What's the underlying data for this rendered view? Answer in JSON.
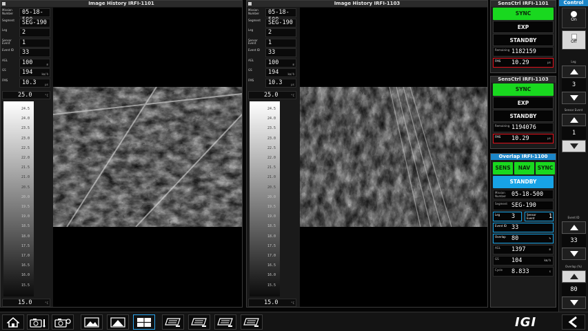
{
  "left_panel": {
    "title": "Image History IRFI-1101",
    "info": [
      {
        "label": "Mission Number",
        "value": "05-18-500",
        "unit": ""
      },
      {
        "label": "Segment",
        "value": "SEG-190",
        "unit": ""
      },
      {
        "label": "Leg",
        "value": "2",
        "unit": ""
      },
      {
        "label": "Sensor Event",
        "value": "1",
        "unit": ""
      },
      {
        "label": "Event ID",
        "value": "33",
        "unit": ""
      },
      {
        "label": "AGL",
        "value": "100",
        "unit": "m"
      },
      {
        "label": "GS",
        "value": "194",
        "unit": "km/h"
      },
      {
        "label": "FMS",
        "value": "10.3",
        "unit": "µs"
      }
    ],
    "scale_top": "25.0",
    "scale_bottom": "15.0",
    "scale_unit": "°C",
    "ticks": [
      "24.5",
      "24.0",
      "23.5",
      "23.0",
      "22.5",
      "22.0",
      "21.5",
      "21.0",
      "20.5",
      "20.0",
      "19.5",
      "19.0",
      "18.5",
      "18.0",
      "17.5",
      "17.0",
      "16.5",
      "16.0",
      "15.5"
    ]
  },
  "right_panel": {
    "title": "Image History IRFI-1103",
    "info": [
      {
        "label": "Mission Number",
        "value": "05-18-500",
        "unit": ""
      },
      {
        "label": "Segment",
        "value": "SEG-190",
        "unit": ""
      },
      {
        "label": "Leg",
        "value": "2",
        "unit": ""
      },
      {
        "label": "Sensor Event",
        "value": "1",
        "unit": ""
      },
      {
        "label": "Event ID",
        "value": "33",
        "unit": ""
      },
      {
        "label": "AGL",
        "value": "100",
        "unit": "m"
      },
      {
        "label": "GS",
        "value": "194",
        "unit": "km/h"
      },
      {
        "label": "FMS",
        "value": "10.3",
        "unit": "µs"
      }
    ],
    "scale_top": "25.0",
    "scale_bottom": "15.0",
    "scale_unit": "°C",
    "ticks": [
      "24.5",
      "24.0",
      "23.5",
      "23.0",
      "22.5",
      "22.0",
      "21.5",
      "21.0",
      "20.5",
      "20.0",
      "19.5",
      "19.0",
      "18.5",
      "18.0",
      "17.5",
      "17.0",
      "16.5",
      "16.0",
      "15.5"
    ]
  },
  "sensctrl1": {
    "title": "SensCtrl IRFI-1101",
    "sync": "SYNC",
    "exp": "EXP",
    "standby": "STANDBY",
    "remaining_label": "Remaining",
    "remaining": "1182159",
    "fms_label": "FMS",
    "fms": "10.29",
    "fms_unit": "µs"
  },
  "sensctrl2": {
    "title": "SensCtrl IRFI-1103",
    "sync": "SYNC",
    "exp": "EXP",
    "standby": "STANDBY",
    "remaining_label": "Remaining",
    "remaining": "1194076",
    "fms_label": "FMS",
    "fms": "10.29",
    "fms_unit": "µs"
  },
  "overlap": {
    "title": "Overlap IRFI-1100",
    "sens": "SENS",
    "nav": "NAV",
    "sync": "SYNC",
    "standby": "STANDBY",
    "mission_label": "Mission Number",
    "mission": "05-18-500",
    "segment_label": "Segment",
    "segment": "SEG-190",
    "leg_label": "Leg",
    "leg": "3",
    "sensor_event_label": "Sensor Event",
    "sensor_event": "1",
    "event_id_label": "Event ID",
    "event_id": "33",
    "overlap_label": "Overlap",
    "overlap": "80",
    "overlap_unit": "%",
    "agl_label": "AGL",
    "agl": "1397",
    "agl_unit": "m",
    "gs_label": "GS",
    "gs": "104",
    "gs_unit": "km/h",
    "cycle_label": "Cycle",
    "cycle": "8.833",
    "cycle_unit": "s"
  },
  "control": {
    "title": "Control",
    "on": "On",
    "off": "Off",
    "leg_label": "Leg",
    "leg": "3",
    "sensor_event_label": "Sensor Event",
    "sensor_event": "1",
    "event_id_label": "Event ID",
    "event_id": "33",
    "overlap_label": "Overlap (%)",
    "overlap": "80"
  },
  "toolbar": {
    "logo": "IGI",
    "buttons": [
      "home-icon",
      "camera-thermo-icon",
      "camera-settings-icon",
      "image-icon",
      "image-mountain-icon",
      "grid-layout-icon",
      "sensor-1-icon",
      "sensor-2-icon",
      "sensor-3-icon",
      "sensor-4-icon"
    ]
  },
  "colors": {
    "sync_green": "#19d81f",
    "fms_red": "#e3101b",
    "accent_cyan": "#17a3e6",
    "selected_blue": "#2ba6ee"
  }
}
